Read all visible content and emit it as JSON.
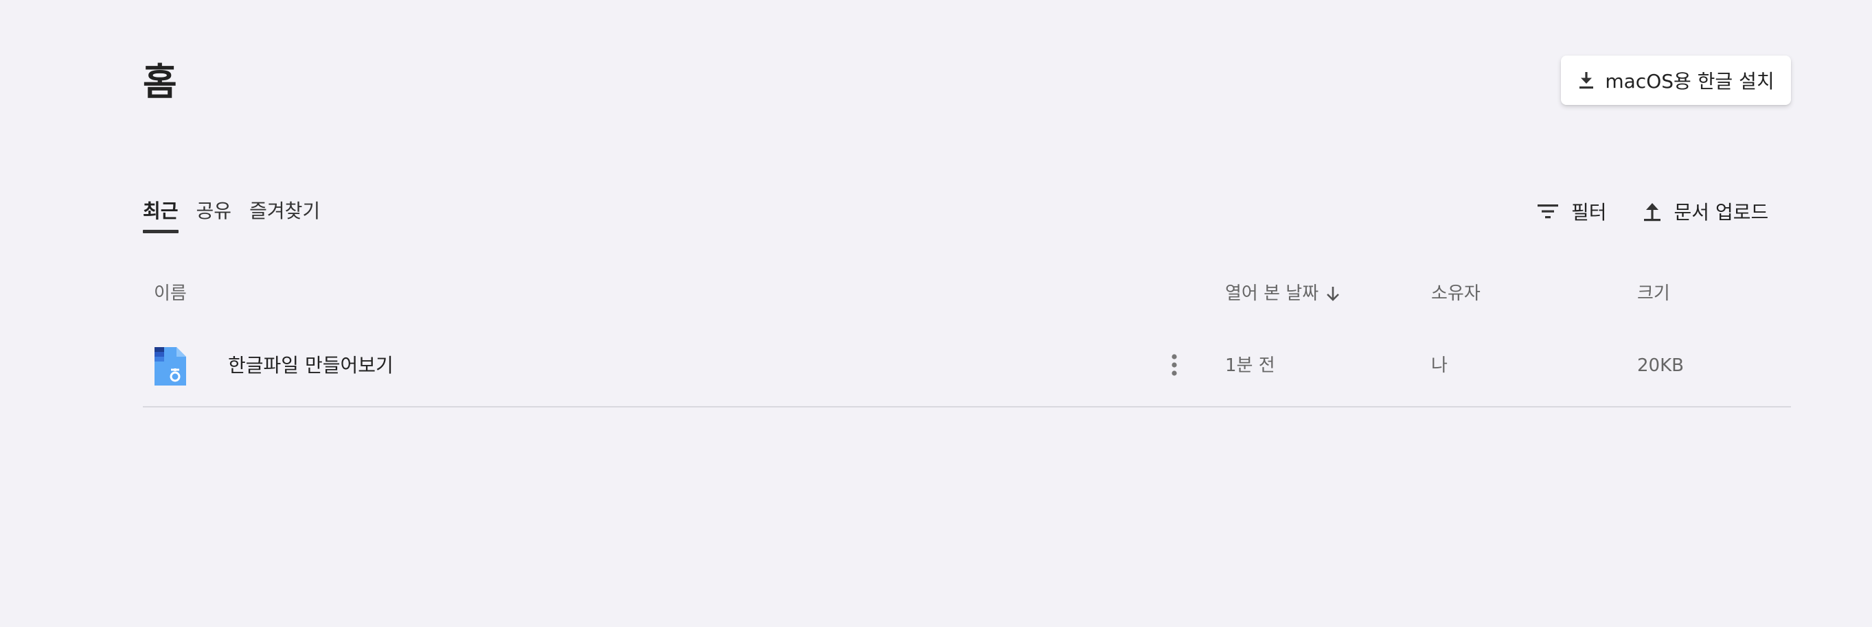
{
  "page": {
    "title": "홈"
  },
  "install_button": {
    "label": "macOS용 한글 설치",
    "icon": "download-icon"
  },
  "tabs": [
    {
      "label": "최근",
      "active": true
    },
    {
      "label": "공유",
      "active": false
    },
    {
      "label": "즐겨찾기",
      "active": false
    }
  ],
  "actions": {
    "filter": {
      "label": "필터",
      "icon": "filter-icon"
    },
    "upload": {
      "label": "문서 업로드",
      "icon": "upload-icon"
    }
  },
  "table": {
    "columns": {
      "name": "이름",
      "opened": "열어 본 날짜",
      "owner": "소유자",
      "size": "크기"
    },
    "sort": {
      "column": "opened",
      "direction": "descending",
      "icon": "arrow-down-icon"
    },
    "rows": [
      {
        "name": "한글파일 만들어보기",
        "opened": "1분 전",
        "owner": "나",
        "size": "20KB",
        "icon": "hwp-document-icon"
      }
    ]
  },
  "colors": {
    "background": "#f3f2f7",
    "text_primary": "#222222",
    "text_secondary": "#666666",
    "divider": "#d8d8de",
    "doc_icon_blue": "#5aa7f5",
    "doc_icon_dark": "#1e3d8f"
  }
}
